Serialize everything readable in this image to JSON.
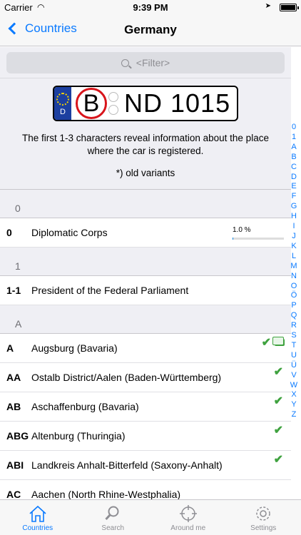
{
  "status": {
    "carrier": "Carrier",
    "time": "9:39 PM",
    "battery_level": 1.0
  },
  "nav": {
    "back_label": "Countries",
    "title": "Germany"
  },
  "search": {
    "placeholder": "<Filter>"
  },
  "plate": {
    "country": "D",
    "district": "B",
    "number": "ND 1015"
  },
  "info": {
    "text": "The first 1-3 characters reveal information about the place where the car is registered.",
    "old_note": "*) old variants"
  },
  "sections": [
    {
      "header": "0",
      "rows": [
        {
          "code": "0",
          "name": "Diplomatic Corps",
          "percent_label": "1.0 %",
          "percent": 0.01
        }
      ]
    },
    {
      "header": "1",
      "rows": [
        {
          "code": "1-1",
          "name": "President of the Federal Parliament"
        }
      ]
    },
    {
      "header": "A",
      "rows": [
        {
          "code": "A",
          "name": "Augsburg (Bavaria)"
        },
        {
          "code": "AA",
          "name": "Ostalb District/Aalen (Baden-Württemberg)"
        },
        {
          "code": "AB",
          "name": "Aschaffenburg (Bavaria)"
        },
        {
          "code": "ABG",
          "name": "Altenburg (Thuringia)"
        },
        {
          "code": "ABI",
          "name": "Landkreis Anhalt-Bitterfeld (Saxony-Anhalt)"
        },
        {
          "code": "AC",
          "name": "Aachen (North Rhine-Westphalia)"
        }
      ]
    }
  ],
  "index": [
    "0",
    "1",
    "A",
    "B",
    "C",
    "D",
    "E",
    "F",
    "G",
    "H",
    "I",
    "J",
    "K",
    "L",
    "M",
    "N",
    "O",
    "Ö",
    "P",
    "Q",
    "R",
    "S",
    "T",
    "U",
    "Ü",
    "V",
    "W",
    "X",
    "Y",
    "Z"
  ],
  "tabs": [
    {
      "label": "Countries",
      "icon": "house-icon"
    },
    {
      "label": "Search",
      "icon": "magnifier-icon"
    },
    {
      "label": "Around me",
      "icon": "crosshair-icon"
    },
    {
      "label": "Settings",
      "icon": "gear-icon"
    }
  ],
  "colors": {
    "accent": "#0a7aff",
    "check": "#3fa23f",
    "plate_red": "#d8141b",
    "eu_blue": "#1c3fa0"
  }
}
